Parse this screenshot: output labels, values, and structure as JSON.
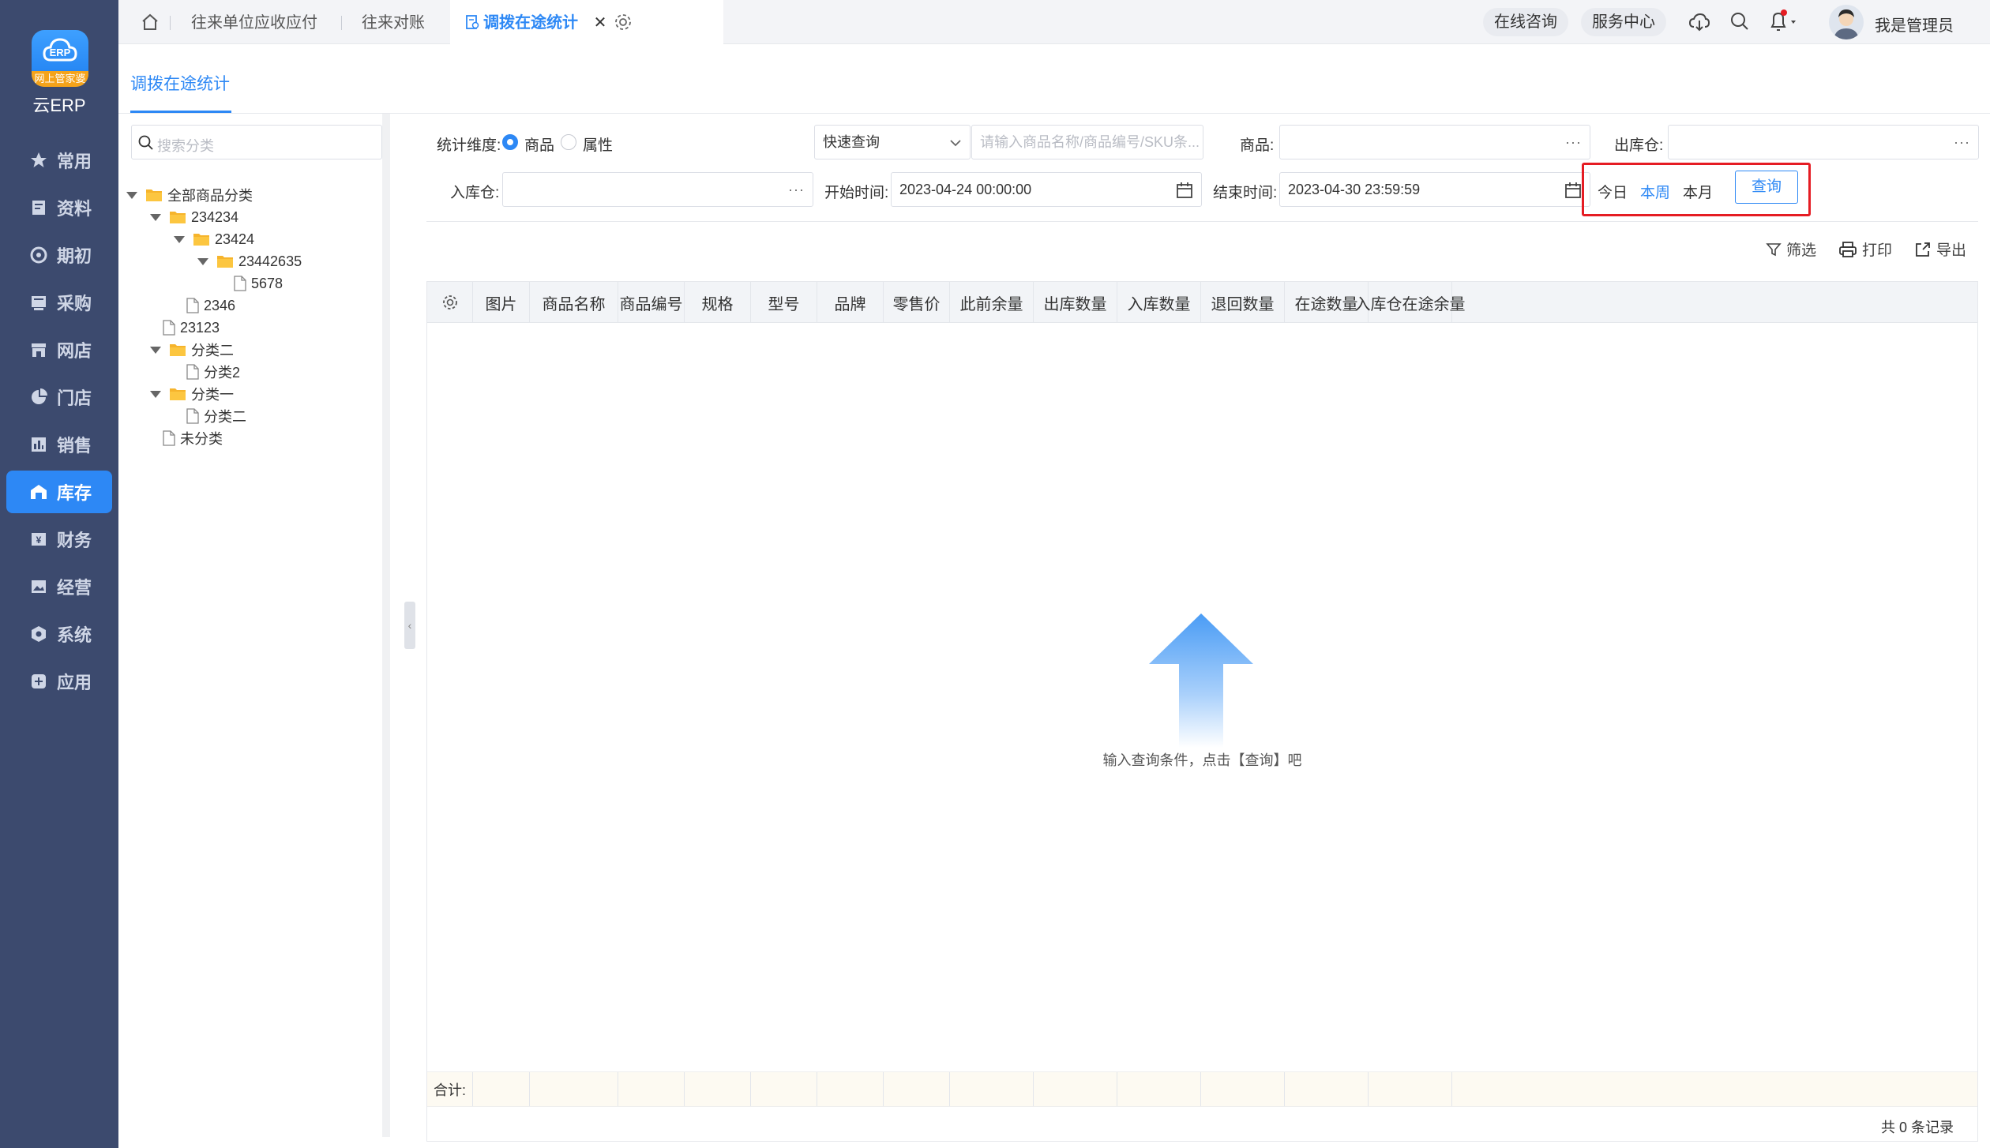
{
  "app": {
    "logo_badge": "网上管家婆",
    "logo_text": "云ERP"
  },
  "sidebar": {
    "items": [
      {
        "label": "常用",
        "icon": "star-icon"
      },
      {
        "label": "资料",
        "icon": "document-icon"
      },
      {
        "label": "期初",
        "icon": "target-icon"
      },
      {
        "label": "采购",
        "icon": "purchase-icon"
      },
      {
        "label": "网店",
        "icon": "shop-icon"
      },
      {
        "label": "门店",
        "icon": "pie-icon"
      },
      {
        "label": "销售",
        "icon": "chart-icon"
      },
      {
        "label": "库存",
        "icon": "warehouse-icon",
        "active": true
      },
      {
        "label": "财务",
        "icon": "finance-icon"
      },
      {
        "label": "经营",
        "icon": "image-icon"
      },
      {
        "label": "系统",
        "icon": "settings-icon"
      },
      {
        "label": "应用",
        "icon": "plus-icon"
      }
    ]
  },
  "topbar": {
    "tabs": [
      "往来单位应收应付",
      "往来对账",
      "调拨在途统计"
    ],
    "online_consult": "在线咨询",
    "service_center": "服务中心",
    "user_name": "我是管理员"
  },
  "page": {
    "tab_label": "调拨在途统计"
  },
  "tree": {
    "search_placeholder": "搜索分类",
    "nodes": [
      {
        "label": "全部商品分类",
        "type": "folder",
        "depth": 0,
        "expanded": true
      },
      {
        "label": "234234",
        "type": "folder",
        "depth": 1,
        "expanded": true
      },
      {
        "label": "23424",
        "type": "folder",
        "depth": 2,
        "expanded": true
      },
      {
        "label": "23442635",
        "type": "folder",
        "depth": 3,
        "expanded": true
      },
      {
        "label": "5678",
        "type": "file",
        "depth": 4
      },
      {
        "label": "2346",
        "type": "file",
        "depth": 2
      },
      {
        "label": "23123",
        "type": "file",
        "depth": 1
      },
      {
        "label": "分类二",
        "type": "folder",
        "depth": 1,
        "expanded": true
      },
      {
        "label": "分类2",
        "type": "file",
        "depth": 2
      },
      {
        "label": "分类一",
        "type": "folder",
        "depth": 1,
        "expanded": true
      },
      {
        "label": "分类二",
        "type": "file",
        "depth": 2
      },
      {
        "label": "未分类",
        "type": "file",
        "depth": 1
      }
    ]
  },
  "filters": {
    "dimension_label": "统计维度:",
    "dimension_opt1": "商品",
    "dimension_opt2": "属性",
    "quick_select": "快速查询",
    "keyword_placeholder": "请输入商品名称/商品编号/SKU条...",
    "product_label": "商品:",
    "out_wh_label": "出库仓:",
    "in_wh_label": "入库仓:",
    "start_label": "开始时间:",
    "start_value": "2023-04-24 00:00:00",
    "end_label": "结束时间:",
    "end_value": "2023-04-30 23:59:59",
    "today": "今日",
    "this_week": "本周",
    "this_month": "本月",
    "query_button": "查询",
    "more_glyph": "···"
  },
  "toolbar": {
    "filter": "筛选",
    "print": "打印",
    "export": "导出"
  },
  "table": {
    "columns": [
      "图片",
      "商品名称",
      "商品编号",
      "规格",
      "型号",
      "品牌",
      "零售价",
      "此前余量",
      "出库数量",
      "入库数量",
      "退回数量",
      "在途数量",
      "入库仓在途余量"
    ],
    "empty_text": "输入查询条件，点击【查询】吧",
    "sum_label": "合计:",
    "record_count": "共 0 条记录"
  },
  "colors": {
    "accent": "#2d88f5",
    "sidebar": "#3c4a6e",
    "highlight_box": "#e51c23"
  }
}
